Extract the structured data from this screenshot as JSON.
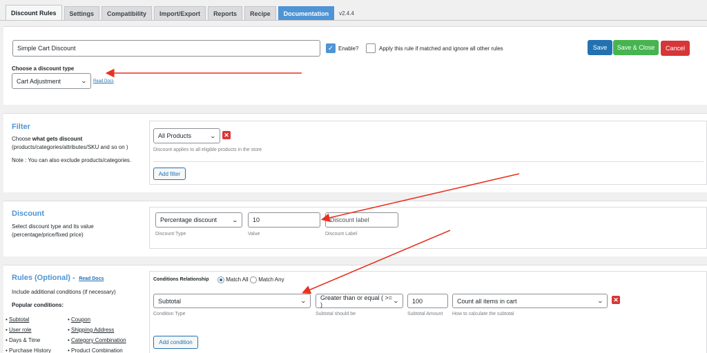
{
  "tabs": [
    {
      "label": "Discount Rules"
    },
    {
      "label": "Settings"
    },
    {
      "label": "Compatibility"
    },
    {
      "label": "Import/Export"
    },
    {
      "label": "Reports"
    },
    {
      "label": "Recipe"
    },
    {
      "label": "Documentation"
    }
  ],
  "version": "v2.4.4",
  "top": {
    "rule_name": "Simple Cart Discount",
    "enable_label": "Enable?",
    "apply_label": "Apply this rule if matched and ignore all other rules",
    "save": "Save",
    "save_close": "Save & Close",
    "cancel": "Cancel",
    "type_label": "Choose a discount type",
    "type_value": "Cart Adjustment",
    "read_docs": "Read Docs"
  },
  "filter": {
    "title": "Filter",
    "desc_prefix": "Choose ",
    "desc_bold": "what gets discount",
    "desc_line2": "(products/categories/attributes/SKU and so on )",
    "note": "Note : You can also exclude products/categories.",
    "select_value": "All Products",
    "help": "Discount applies to all eligible products in the store",
    "add_filter": "Add filter"
  },
  "discount": {
    "title": "Discount",
    "desc1": "Select discount type and its value",
    "desc2": "(percentage/price/fixed price)",
    "type_value": "Percentage discount",
    "value": "10",
    "label_placeholder": "Discount label",
    "type_caption": "Discount Type",
    "value_caption": "Value",
    "label_caption": "Discount Label"
  },
  "rules": {
    "title": "Rules (Optional) -",
    "read_docs": "Read Docs",
    "desc": "Include additional conditions (if necessary)",
    "popular": "Popular conditions:",
    "col1": [
      "Subtotal",
      "User role",
      "Days & Time",
      "Purchase History"
    ],
    "col2": [
      "Coupon",
      "Shipping Address",
      "Category Combination",
      "Product Combination"
    ],
    "relationship_label": "Conditions Relationship",
    "match_all": "Match All",
    "match_any": "Match Any",
    "condition_type": "Subtotal",
    "operator": "Greater than or equal ( >= )",
    "amount": "100",
    "calc": "Count all items in cart",
    "cap_type": "Condition Type",
    "cap_operator": "Subtotal should be",
    "cap_amount": "Subtotal Amount",
    "cap_calc": "How to calculate the subtotal",
    "add_condition": "Add condition"
  },
  "colors": {
    "accent": "#4f94d4",
    "save": "#2271b1",
    "save_close": "#46b450",
    "cancel": "#d63638",
    "arrow": "#e8321f"
  }
}
